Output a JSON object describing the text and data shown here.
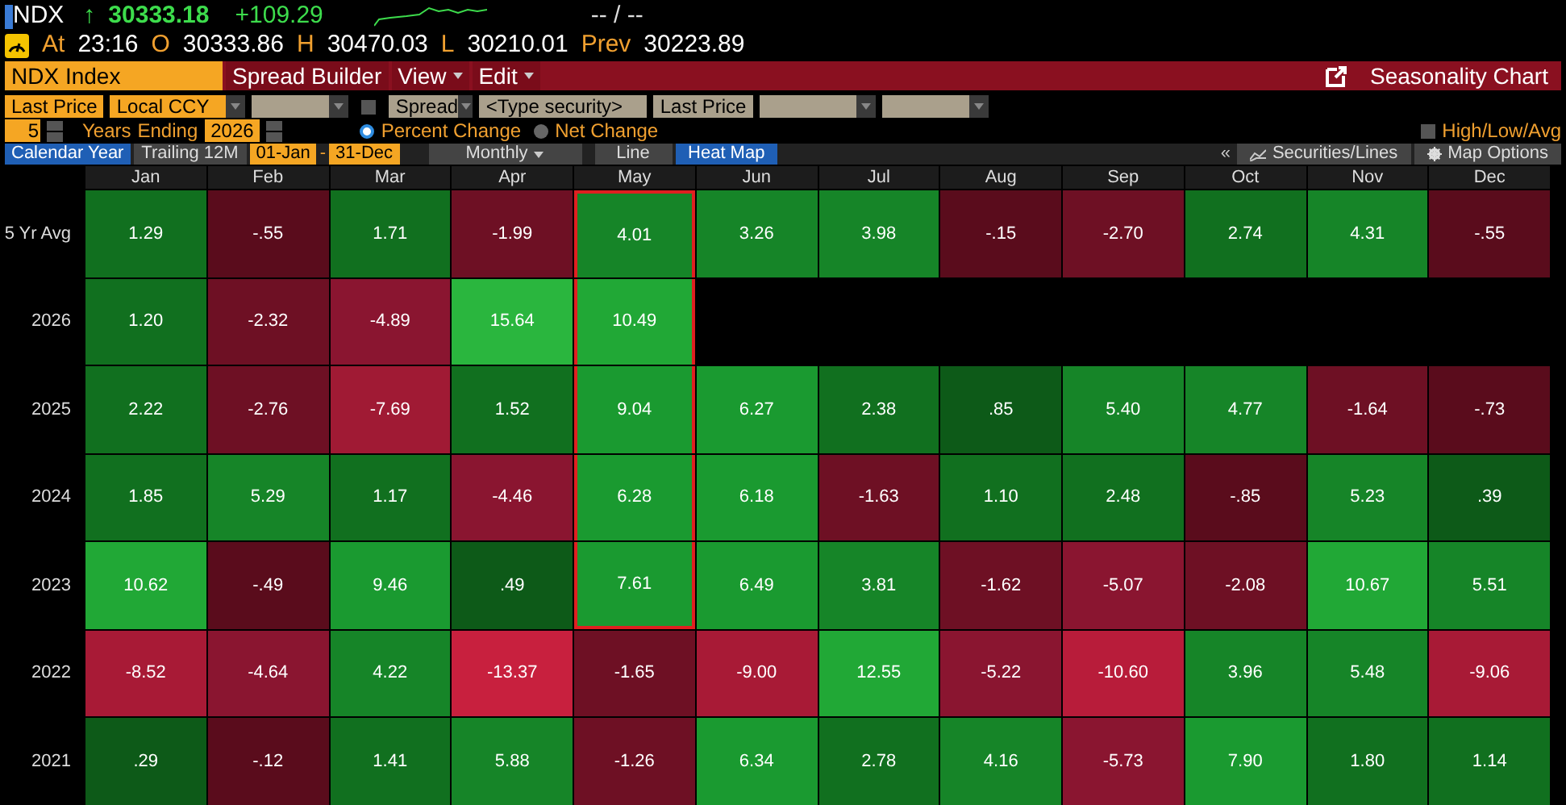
{
  "ticker": {
    "symbol": "NDX",
    "arrow": "↑",
    "last": "30333.18",
    "change": "+109.29",
    "bid_ask": "-- / --"
  },
  "quote": {
    "at_label": "At",
    "time": "23:16",
    "open_label": "O",
    "open": "30333.86",
    "high_label": "H",
    "high": "30470.03",
    "low_label": "L",
    "low": "30210.01",
    "prev_label": "Prev",
    "prev": "30223.89"
  },
  "toolbar": {
    "security": "NDX Index",
    "menus": [
      {
        "label": "Spread Builder",
        "dropdown": false
      },
      {
        "label": "View",
        "dropdown": true
      },
      {
        "label": "Edit",
        "dropdown": true
      }
    ],
    "title": "Seasonality Chart"
  },
  "controls": {
    "field": "Last Price",
    "currency": "Local CCY",
    "spread_checked": false,
    "spread": "Spread",
    "security_placeholder": "<Type security>",
    "field2": "Last Price",
    "years": "5",
    "years_label": "Years",
    "ending_label": "Ending",
    "end_year": "2026",
    "radios": [
      {
        "label": "Percent Change",
        "selected": true
      },
      {
        "label": "Net Change",
        "selected": false
      }
    ],
    "high_low_avg": {
      "label": "High/Low/Avg",
      "checked": false
    }
  },
  "view_bar": {
    "periods": [
      {
        "label": "Calendar Year",
        "selected": true
      },
      {
        "label": "Trailing 12M",
        "selected": false
      }
    ],
    "start": "01-Jan",
    "dash": "-",
    "end": "31-Dec",
    "frequency": "Monthly",
    "views": [
      {
        "label": "Line",
        "selected": false
      },
      {
        "label": "Heat Map",
        "selected": true
      }
    ],
    "collapse": "«",
    "buttons": [
      "Securities/Lines",
      "Map Options"
    ]
  },
  "heat_map": {
    "months": [
      "Jan",
      "Feb",
      "Mar",
      "Apr",
      "May",
      "Jun",
      "Jul",
      "Aug",
      "Sep",
      "Oct",
      "Nov",
      "Dec"
    ],
    "rows": [
      {
        "label": "5 Yr Avg",
        "cells": [
          {
            "value": "1.29",
            "color": "#11701f",
            "outlined": false
          },
          {
            "value": "-.55",
            "color": "#5a0c1c",
            "outlined": false
          },
          {
            "value": "1.71",
            "color": "#11701f",
            "outlined": false
          },
          {
            "value": "-1.99",
            "color": "#6e1024",
            "outlined": false
          },
          {
            "value": "4.01",
            "color": "#168528",
            "outlined": true
          },
          {
            "value": "3.26",
            "color": "#168528",
            "outlined": false
          },
          {
            "value": "3.98",
            "color": "#168528",
            "outlined": false
          },
          {
            "value": "-.15",
            "color": "#5a0c1c",
            "outlined": false
          },
          {
            "value": "-2.70",
            "color": "#6e1024",
            "outlined": false
          },
          {
            "value": "2.74",
            "color": "#11701f",
            "outlined": false
          },
          {
            "value": "4.31",
            "color": "#168528",
            "outlined": false
          },
          {
            "value": "-.55",
            "color": "#5a0c1c",
            "outlined": false
          }
        ]
      },
      {
        "label": "2026",
        "cells": [
          {
            "value": "1.20",
            "color": "#11701f",
            "outlined": false
          },
          {
            "value": "-2.32",
            "color": "#6e1024",
            "outlined": false
          },
          {
            "value": "-4.89",
            "color": "#8a1530",
            "outlined": false
          },
          {
            "value": "15.64",
            "color": "#2ab63e",
            "outlined": false
          },
          {
            "value": "10.49",
            "color": "#21a836",
            "outlined": true
          }
        ]
      },
      {
        "label": "2025",
        "cells": [
          {
            "value": "2.22",
            "color": "#11701f",
            "outlined": false
          },
          {
            "value": "-2.76",
            "color": "#6e1024",
            "outlined": false
          },
          {
            "value": "-7.69",
            "color": "#a01a34",
            "outlined": false
          },
          {
            "value": "1.52",
            "color": "#11701f",
            "outlined": false
          },
          {
            "value": "9.04",
            "color": "#1a9a30",
            "outlined": true
          },
          {
            "value": "6.27",
            "color": "#1a9a30",
            "outlined": false
          },
          {
            "value": "2.38",
            "color": "#11701f",
            "outlined": false
          },
          {
            "value": ".85",
            "color": "#0d5a18",
            "outlined": false
          },
          {
            "value": "5.40",
            "color": "#168528",
            "outlined": false
          },
          {
            "value": "4.77",
            "color": "#168528",
            "outlined": false
          },
          {
            "value": "-1.64",
            "color": "#6e1024",
            "outlined": false
          },
          {
            "value": "-.73",
            "color": "#5a0c1c",
            "outlined": false
          }
        ]
      },
      {
        "label": "2024",
        "cells": [
          {
            "value": "1.85",
            "color": "#11701f",
            "outlined": false
          },
          {
            "value": "5.29",
            "color": "#168528",
            "outlined": false
          },
          {
            "value": "1.17",
            "color": "#11701f",
            "outlined": false
          },
          {
            "value": "-4.46",
            "color": "#8a1530",
            "outlined": false
          },
          {
            "value": "6.28",
            "color": "#1a9a30",
            "outlined": true
          },
          {
            "value": "6.18",
            "color": "#1a9a30",
            "outlined": false
          },
          {
            "value": "-1.63",
            "color": "#6e1024",
            "outlined": false
          },
          {
            "value": "1.10",
            "color": "#11701f",
            "outlined": false
          },
          {
            "value": "2.48",
            "color": "#11701f",
            "outlined": false
          },
          {
            "value": "-.85",
            "color": "#5a0c1c",
            "outlined": false
          },
          {
            "value": "5.23",
            "color": "#168528",
            "outlined": false
          },
          {
            "value": ".39",
            "color": "#0d5a18",
            "outlined": false
          }
        ]
      },
      {
        "label": "2023",
        "cells": [
          {
            "value": "10.62",
            "color": "#21a836",
            "outlined": false
          },
          {
            "value": "-.49",
            "color": "#5a0c1c",
            "outlined": false
          },
          {
            "value": "9.46",
            "color": "#1a9a30",
            "outlined": false
          },
          {
            "value": ".49",
            "color": "#0d5a18",
            "outlined": false
          },
          {
            "value": "7.61",
            "color": "#1a9a30",
            "outlined": true
          },
          {
            "value": "6.49",
            "color": "#1a9a30",
            "outlined": false
          },
          {
            "value": "3.81",
            "color": "#168528",
            "outlined": false
          },
          {
            "value": "-1.62",
            "color": "#6e1024",
            "outlined": false
          },
          {
            "value": "-5.07",
            "color": "#8a1530",
            "outlined": false
          },
          {
            "value": "-2.08",
            "color": "#6e1024",
            "outlined": false
          },
          {
            "value": "10.67",
            "color": "#21a836",
            "outlined": false
          },
          {
            "value": "5.51",
            "color": "#168528",
            "outlined": false
          }
        ]
      },
      {
        "label": "2022",
        "cells": [
          {
            "value": "-8.52",
            "color": "#a81a36",
            "outlined": false
          },
          {
            "value": "-4.64",
            "color": "#8a1530",
            "outlined": false
          },
          {
            "value": "4.22",
            "color": "#168528",
            "outlined": false
          },
          {
            "value": "-13.37",
            "color": "#c8203e",
            "outlined": false
          },
          {
            "value": "-1.65",
            "color": "#6e1024",
            "outlined": false
          },
          {
            "value": "-9.00",
            "color": "#a81a36",
            "outlined": false
          },
          {
            "value": "12.55",
            "color": "#21a836",
            "outlined": false
          },
          {
            "value": "-5.22",
            "color": "#8a1530",
            "outlined": false
          },
          {
            "value": "-10.60",
            "color": "#b81c3a",
            "outlined": false
          },
          {
            "value": "3.96",
            "color": "#168528",
            "outlined": false
          },
          {
            "value": "5.48",
            "color": "#168528",
            "outlined": false
          },
          {
            "value": "-9.06",
            "color": "#a81a36",
            "outlined": false
          }
        ]
      },
      {
        "label": "2021",
        "cells": [
          {
            "value": ".29",
            "color": "#0d5a18",
            "outlined": false
          },
          {
            "value": "-.12",
            "color": "#5a0c1c",
            "outlined": false
          },
          {
            "value": "1.41",
            "color": "#11701f",
            "outlined": false
          },
          {
            "value": "5.88",
            "color": "#168528",
            "outlined": false
          },
          {
            "value": "-1.26",
            "color": "#6e1024",
            "outlined": false
          },
          {
            "value": "6.34",
            "color": "#1a9a30",
            "outlined": false
          },
          {
            "value": "2.78",
            "color": "#11701f",
            "outlined": false
          },
          {
            "value": "4.16",
            "color": "#168528",
            "outlined": false
          },
          {
            "value": "-5.73",
            "color": "#8a1530",
            "outlined": false
          },
          {
            "value": "7.90",
            "color": "#1a9a30",
            "outlined": false
          },
          {
            "value": "1.80",
            "color": "#11701f",
            "outlined": false
          },
          {
            "value": "1.14",
            "color": "#11701f",
            "outlined": false
          }
        ]
      }
    ]
  }
}
